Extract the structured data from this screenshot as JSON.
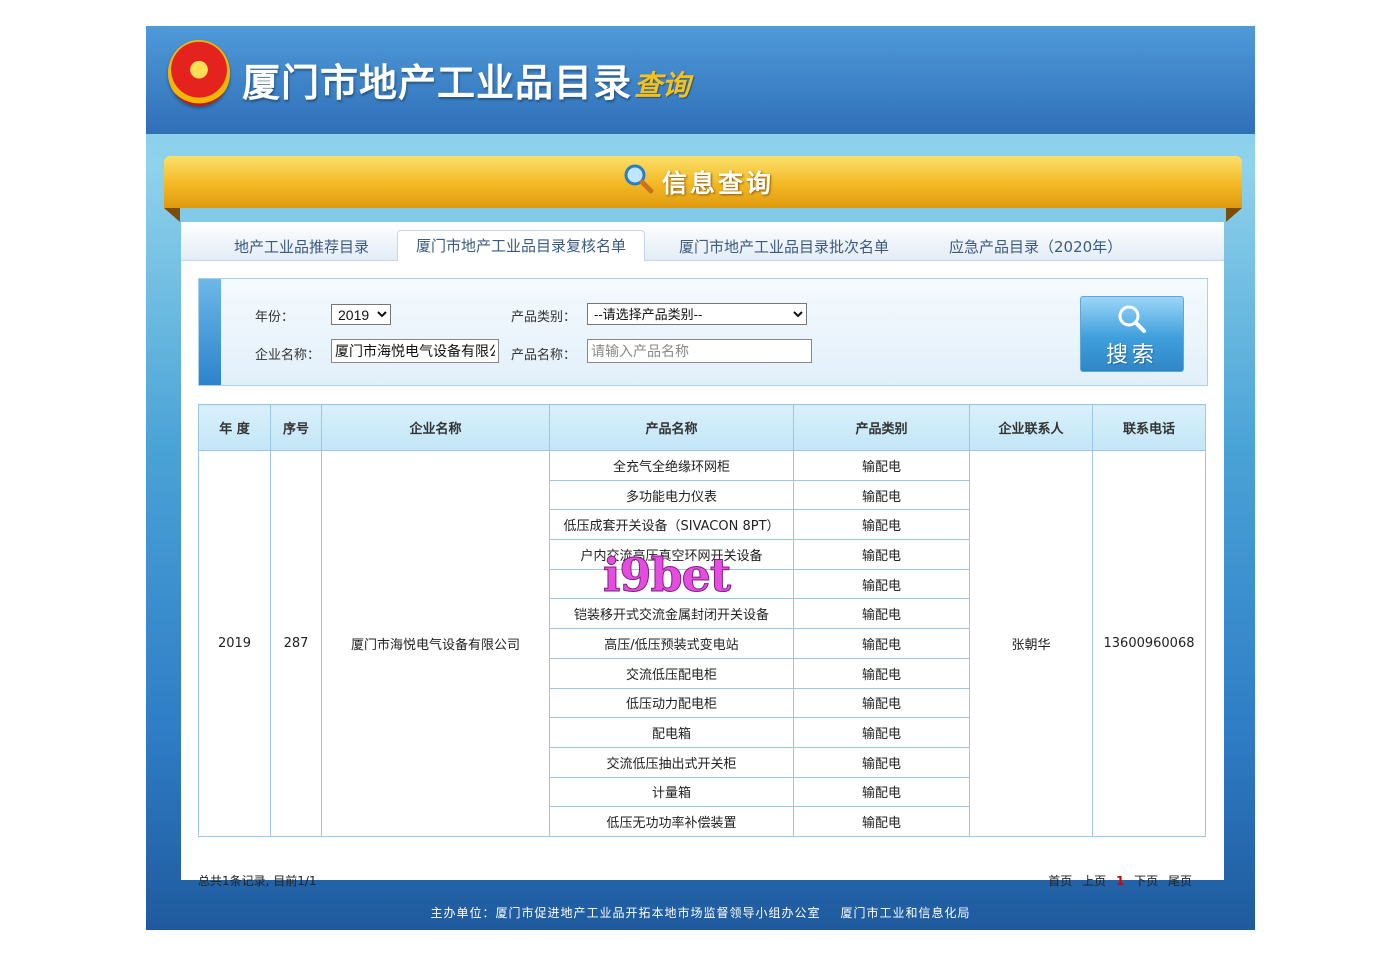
{
  "header": {
    "site_title": "厦门市地产工业品目录",
    "site_subtitle": "查询",
    "emblem_icon": "national-emblem-icon"
  },
  "banner": {
    "title": "信息查询",
    "icon": "magnifier-icon"
  },
  "tabs": [
    {
      "label": "地产工业品推荐目录",
      "active": false
    },
    {
      "label": "厦门市地产工业品目录复核名单",
      "active": true
    },
    {
      "label": "厦门市地产工业品目录批次名单",
      "active": false
    },
    {
      "label": "应急产品目录（2020年）",
      "active": false
    }
  ],
  "search": {
    "year_label": "年份：",
    "year_value": "2019",
    "category_label": "产品类别：",
    "category_value": "--请选择产品类别--",
    "company_label": "企业名称：",
    "company_value": "厦门市海悦电气设备有限公司",
    "product_label": "产品名称：",
    "product_placeholder": "请输入产品名称",
    "button_label": "搜索"
  },
  "table": {
    "headers": [
      "年 度",
      "序号",
      "企业名称",
      "产品名称",
      "产品类别",
      "企业联系人",
      "联系电话"
    ],
    "record": {
      "year": "2019",
      "seq": "287",
      "company": "厦门市海悦电气设备有限公司",
      "contact": "张朝华",
      "phone": "13600960068",
      "products": [
        {
          "name": "全充气全绝缘环网柜",
          "category": "输配电"
        },
        {
          "name": "多功能电力仪表",
          "category": "输配电"
        },
        {
          "name": "低压成套开关设备（SIVACON 8PT）",
          "category": "输配电"
        },
        {
          "name": "户内交流高压真空环网开关设备",
          "category": "输配电"
        },
        {
          "name": "",
          "category": "输配电"
        },
        {
          "name": "铠装移开式交流金属封闭开关设备",
          "category": "输配电"
        },
        {
          "name": "高压/低压预装式变电站",
          "category": "输配电"
        },
        {
          "name": "交流低压配电柜",
          "category": "输配电"
        },
        {
          "name": "低压动力配电柜",
          "category": "输配电"
        },
        {
          "name": "配电箱",
          "category": "输配电"
        },
        {
          "name": "交流低压抽出式开关柜",
          "category": "输配电"
        },
        {
          "name": "计量箱",
          "category": "输配电"
        },
        {
          "name": "低压无功功率补偿装置",
          "category": "输配电"
        }
      ]
    }
  },
  "summary": "总共1条记录, 目前1/1",
  "pager": {
    "first": "首页",
    "prev": "上页",
    "current": "1",
    "next": "下页",
    "last": "尾页"
  },
  "watermark": "i9bet",
  "footer": {
    "host_label": "主办单位：",
    "org1": "厦门市促进地产工业品开拓本地市场监督领导小组办公室",
    "org2": "厦门市工业和信息化局"
  },
  "colors": {
    "header_blue": "#2f6fb8",
    "banner_gold": "#f3b823",
    "table_header": "#c3e6f7",
    "pager_current": "#d60000"
  }
}
